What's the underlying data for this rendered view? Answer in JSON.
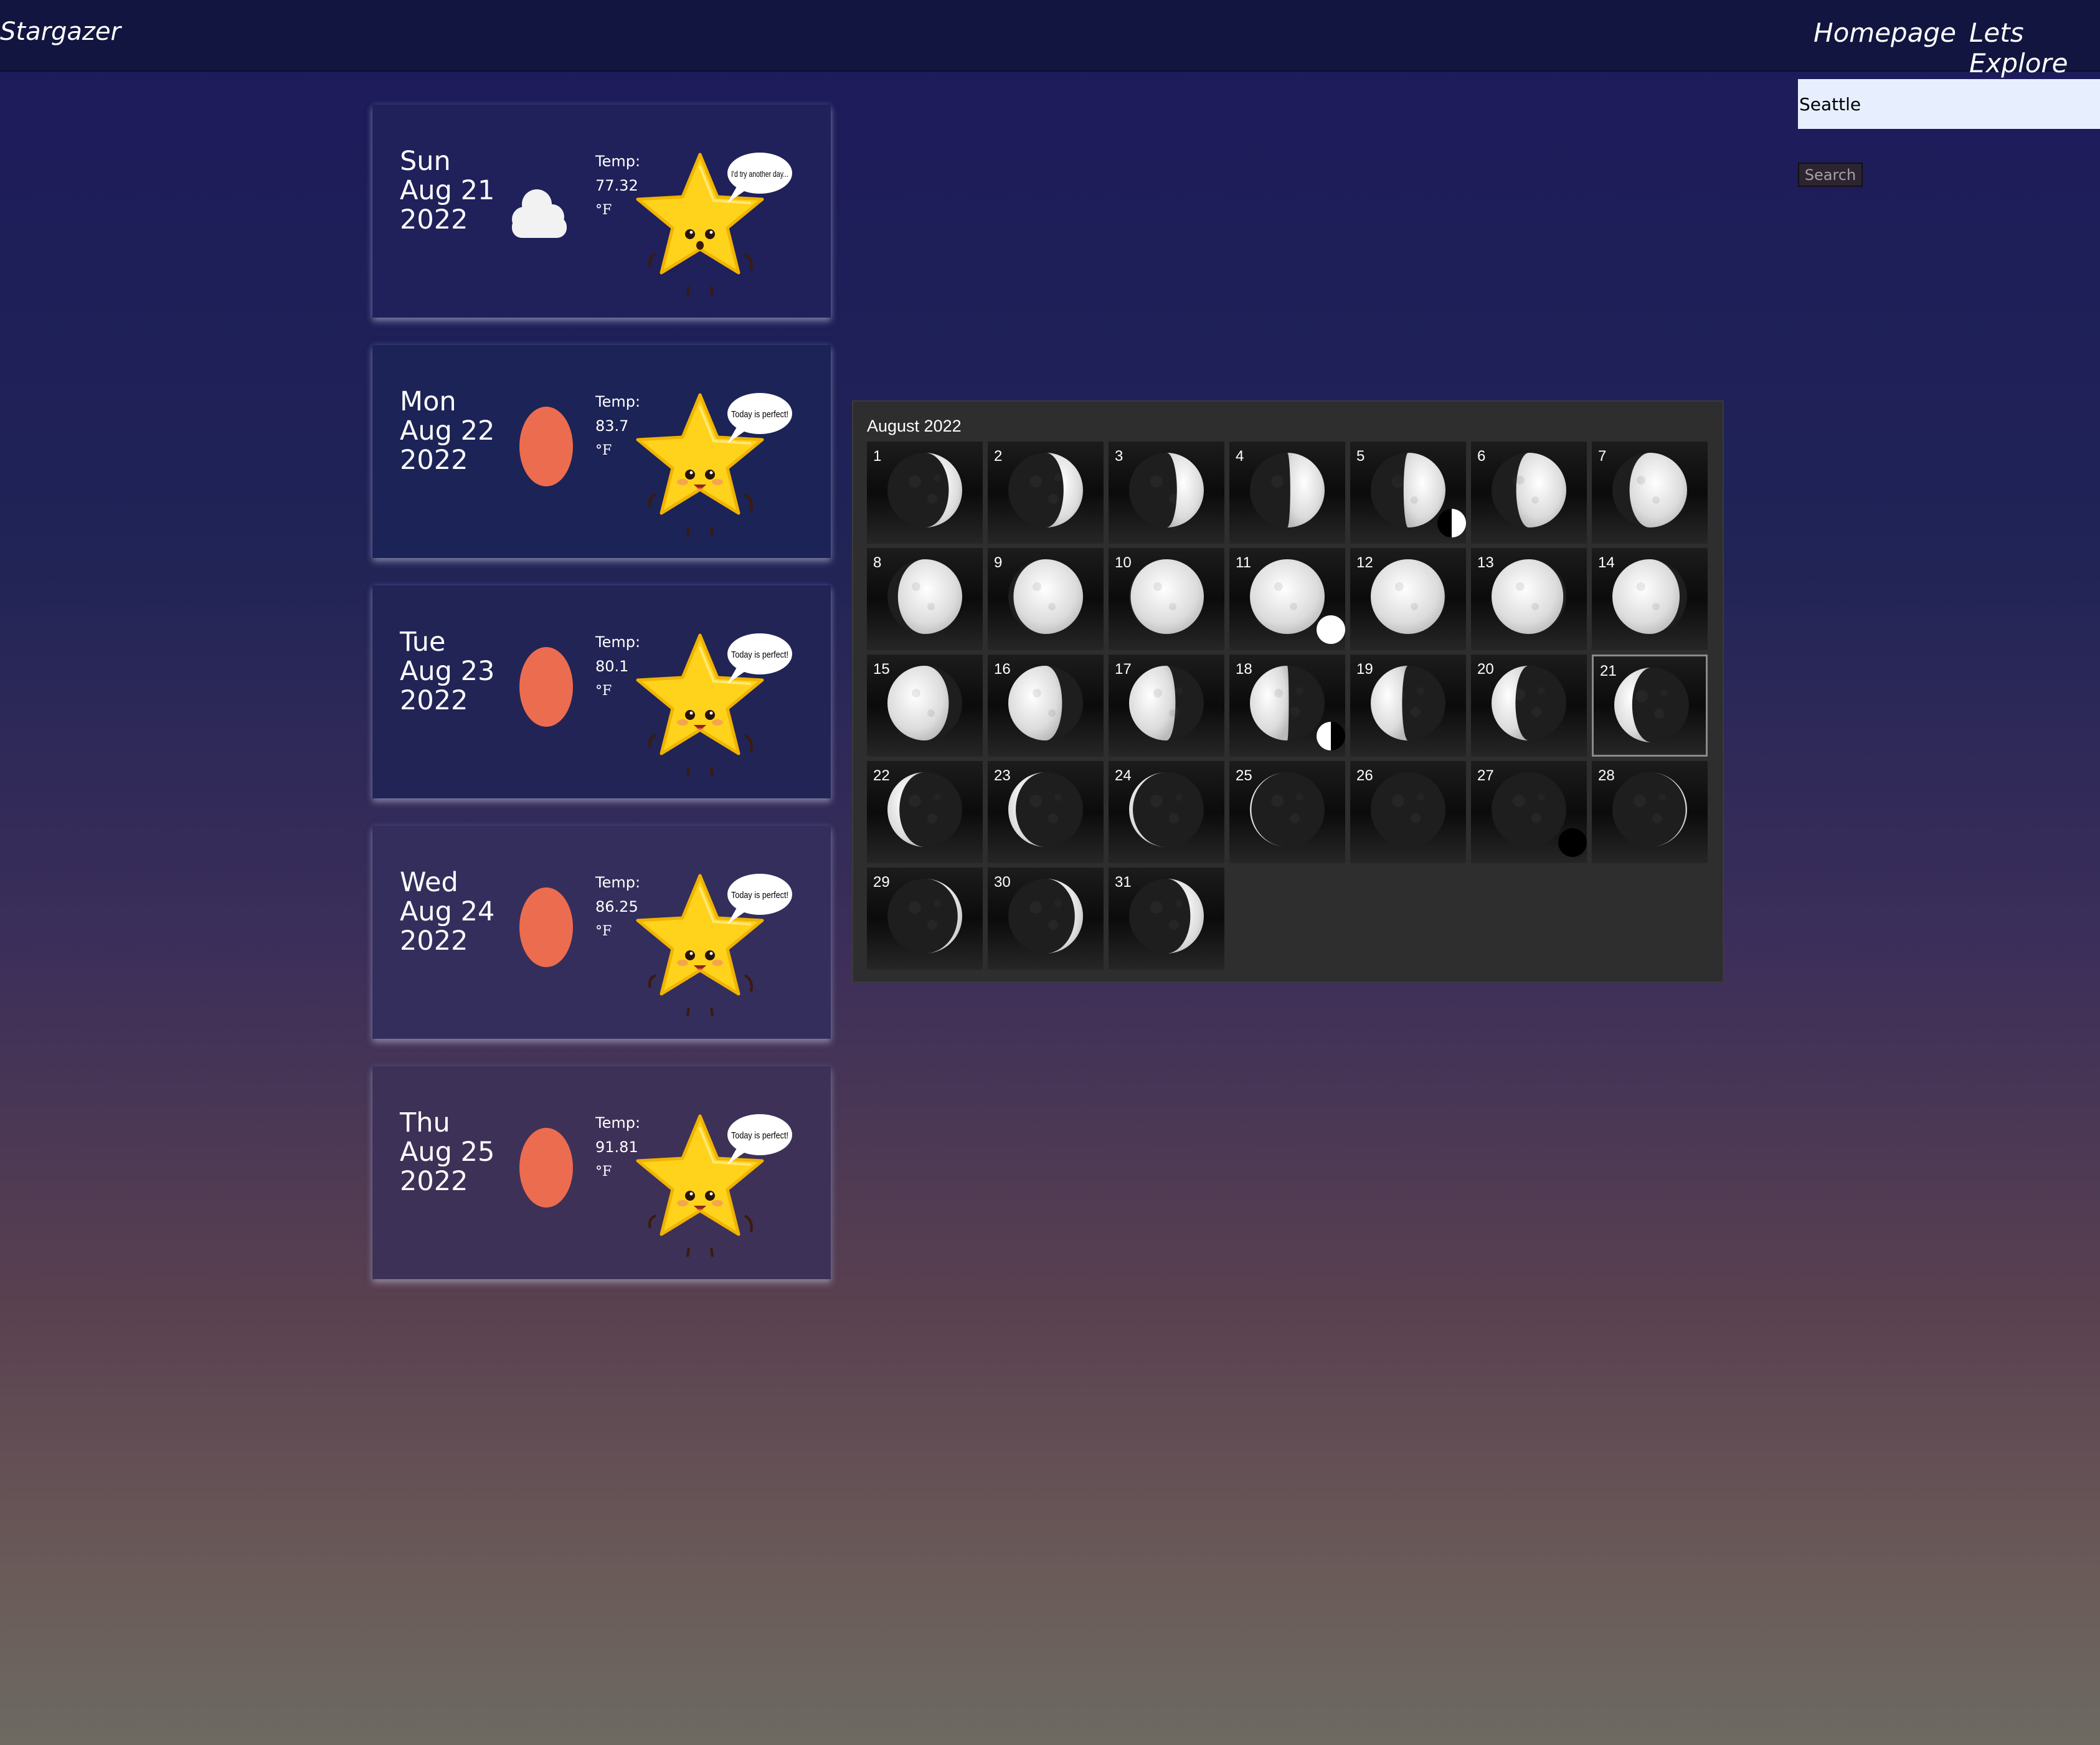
{
  "app": {
    "brand": "Stargazer"
  },
  "nav": {
    "links": [
      "Homepage",
      "Lets Explore"
    ]
  },
  "search": {
    "value": "Seattle",
    "placeholder": "",
    "button_label": "Search"
  },
  "forecast": [
    {
      "weekday": "Sun",
      "monthday": "Aug 21",
      "year": "2022",
      "weather_icon": "cloud-icon",
      "temp_label": "Temp:",
      "temp": "77.32",
      "unit": "°F",
      "star_mood": "sad",
      "star_says": "I'd try another day..."
    },
    {
      "weekday": "Mon",
      "monthday": "Aug 22",
      "year": "2022",
      "weather_icon": "clear-icon",
      "temp_label": "Temp:",
      "temp": "83.7",
      "unit": "°F",
      "star_mood": "happy",
      "star_says": "Today is perfect!"
    },
    {
      "weekday": "Tue",
      "monthday": "Aug 23",
      "year": "2022",
      "weather_icon": "clear-icon",
      "temp_label": "Temp:",
      "temp": "80.1",
      "unit": "°F",
      "star_mood": "happy",
      "star_says": "Today is perfect!"
    },
    {
      "weekday": "Wed",
      "monthday": "Aug 24",
      "year": "2022",
      "weather_icon": "clear-icon",
      "temp_label": "Temp:",
      "temp": "86.25",
      "unit": "°F",
      "star_mood": "happy",
      "star_says": "Today is perfect!"
    },
    {
      "weekday": "Thu",
      "monthday": "Aug 25",
      "year": "2022",
      "weather_icon": "clear-icon",
      "temp_label": "Temp:",
      "temp": "91.81",
      "unit": "°F",
      "star_mood": "happy",
      "star_says": "Today is perfect!"
    }
  ],
  "calendar": {
    "title": "August 2022",
    "selected_day": 21,
    "days": [
      {
        "day": "1",
        "lit": 0.18,
        "waxing": true
      },
      {
        "day": "2",
        "lit": 0.26,
        "waxing": true
      },
      {
        "day": "3",
        "lit": 0.36,
        "waxing": true
      },
      {
        "day": "4",
        "lit": 0.46,
        "waxing": true
      },
      {
        "day": "5",
        "lit": 0.56,
        "waxing": true,
        "phase_marker": "first-quarter"
      },
      {
        "day": "6",
        "lit": 0.67,
        "waxing": true
      },
      {
        "day": "7",
        "lit": 0.77,
        "waxing": true
      },
      {
        "day": "8",
        "lit": 0.86,
        "waxing": true
      },
      {
        "day": "9",
        "lit": 0.93,
        "waxing": true
      },
      {
        "day": "10",
        "lit": 0.98,
        "waxing": true
      },
      {
        "day": "11",
        "lit": 1.0,
        "waxing": true,
        "phase_marker": "full-moon"
      },
      {
        "day": "12",
        "lit": 0.99,
        "waxing": false
      },
      {
        "day": "13",
        "lit": 0.96,
        "waxing": false
      },
      {
        "day": "14",
        "lit": 0.9,
        "waxing": false
      },
      {
        "day": "15",
        "lit": 0.82,
        "waxing": false
      },
      {
        "day": "16",
        "lit": 0.72,
        "waxing": false
      },
      {
        "day": "17",
        "lit": 0.62,
        "waxing": false
      },
      {
        "day": "18",
        "lit": 0.52,
        "waxing": false,
        "phase_marker": "last-quarter"
      },
      {
        "day": "19",
        "lit": 0.42,
        "waxing": false
      },
      {
        "day": "20",
        "lit": 0.32,
        "waxing": false
      },
      {
        "day": "21",
        "lit": 0.24,
        "waxing": false
      },
      {
        "day": "22",
        "lit": 0.16,
        "waxing": false
      },
      {
        "day": "23",
        "lit": 0.1,
        "waxing": false
      },
      {
        "day": "24",
        "lit": 0.05,
        "waxing": false
      },
      {
        "day": "25",
        "lit": 0.02,
        "waxing": false
      },
      {
        "day": "26",
        "lit": 0.0,
        "waxing": false
      },
      {
        "day": "27",
        "lit": 0.0,
        "waxing": true,
        "phase_marker": "new-moon"
      },
      {
        "day": "28",
        "lit": 0.02,
        "waxing": true
      },
      {
        "day": "29",
        "lit": 0.06,
        "waxing": true
      },
      {
        "day": "30",
        "lit": 0.11,
        "waxing": true
      },
      {
        "day": "31",
        "lit": 0.18,
        "waxing": true
      }
    ]
  },
  "colors": {
    "navbar": "#11153f",
    "sun_icon": "#ec6c4f",
    "star": "#ffd21c",
    "calendar_bg": "#2e2e2e",
    "moon_lit": "#e6e6e6"
  }
}
